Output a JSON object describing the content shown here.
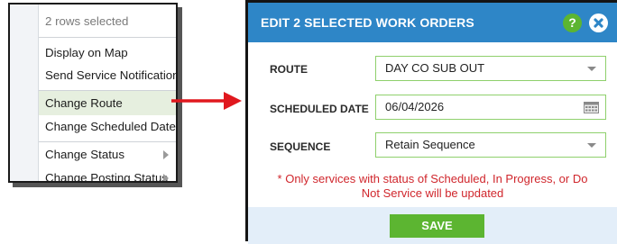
{
  "context_menu": {
    "header": "2 rows selected",
    "items": [
      {
        "label": "Display on Map"
      },
      {
        "label": "Send Service Notification"
      },
      {
        "label": "Change Route"
      },
      {
        "label": "Change Scheduled Date"
      },
      {
        "label": "Change Status"
      },
      {
        "label": "Change Posting Status"
      }
    ]
  },
  "dialog": {
    "title": "EDIT 2 SELECTED WORK ORDERS",
    "help_label": "?",
    "fields": {
      "route": {
        "label": "ROUTE",
        "value": "DAY CO SUB OUT"
      },
      "scheduled_date": {
        "label": "SCHEDULED DATE",
        "value": "06/04/2026"
      },
      "sequence": {
        "label": "SEQUENCE",
        "value": "Retain Sequence"
      }
    },
    "note_line1": "* Only services with status of Scheduled, In Progress, or Do",
    "note_line2": "Not Service will be updated",
    "save_label": "SAVE"
  },
  "colors": {
    "header_blue": "#2e86c7",
    "accent_green": "#5cb531",
    "field_border_green": "#8fd06c",
    "note_red": "#d0262c",
    "arrow_red": "#e0181e",
    "footer_blue": "#e3eef9"
  },
  "icons": {
    "help": "question-circle-icon",
    "close": "close-x-icon",
    "calendar": "calendar-grid-icon",
    "dropdown": "caret-down-icon",
    "submenu": "caret-right-icon",
    "annotation": "red-arrow"
  }
}
